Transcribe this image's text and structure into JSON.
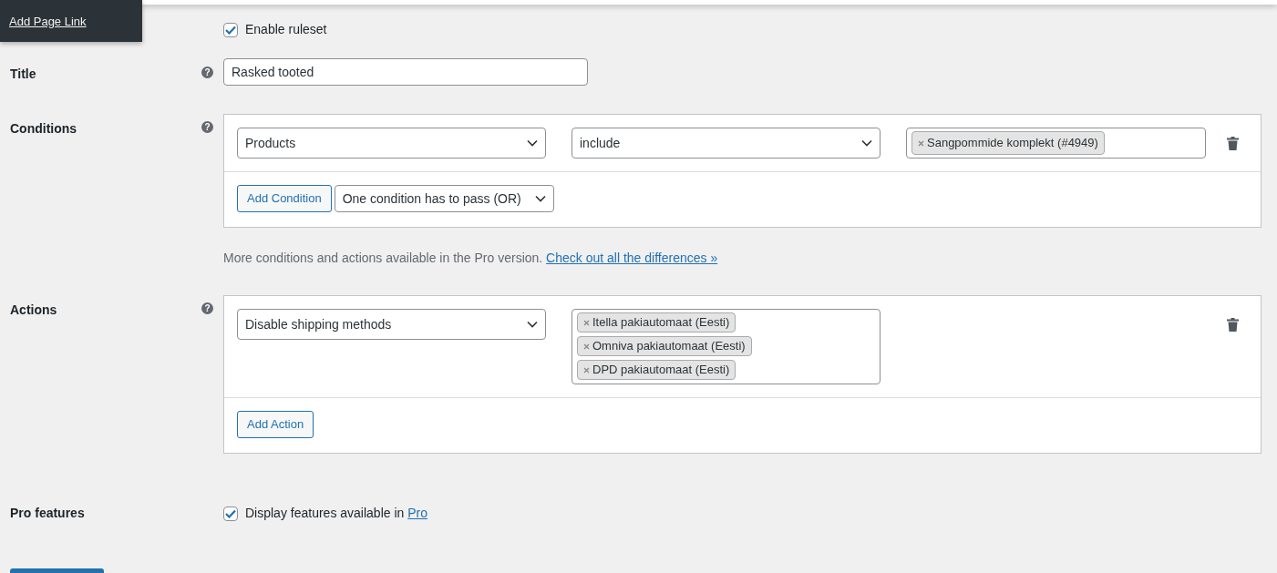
{
  "menu": {
    "items": [
      "Add Page Link"
    ]
  },
  "enable": {
    "label": "Enable ruleset",
    "checked": true
  },
  "title": {
    "label": "Title",
    "help": "?",
    "value": "Rasked tooted"
  },
  "conditions": {
    "label": "Conditions",
    "help": "?",
    "rows": [
      {
        "field": "Products",
        "operator": "include",
        "values": [
          "Sangpommide komplekt (#4949)"
        ]
      }
    ],
    "add_button": "Add Condition",
    "mode": "One condition has to pass (OR)"
  },
  "note": {
    "text": "More conditions and actions available in the Pro version.",
    "link": "Check out all the differences »"
  },
  "actions": {
    "label": "Actions",
    "help": "?",
    "rows": [
      {
        "action": "Disable shipping methods",
        "values": [
          "Itella pakiautomaat (Eesti)",
          "Omniva pakiautomaat (Eesti)",
          "DPD pakiautomaat (Eesti)"
        ]
      }
    ],
    "add_button": "Add Action"
  },
  "pro": {
    "label": "Pro features",
    "checked": true,
    "text": "Display features available in",
    "link": "Pro"
  }
}
